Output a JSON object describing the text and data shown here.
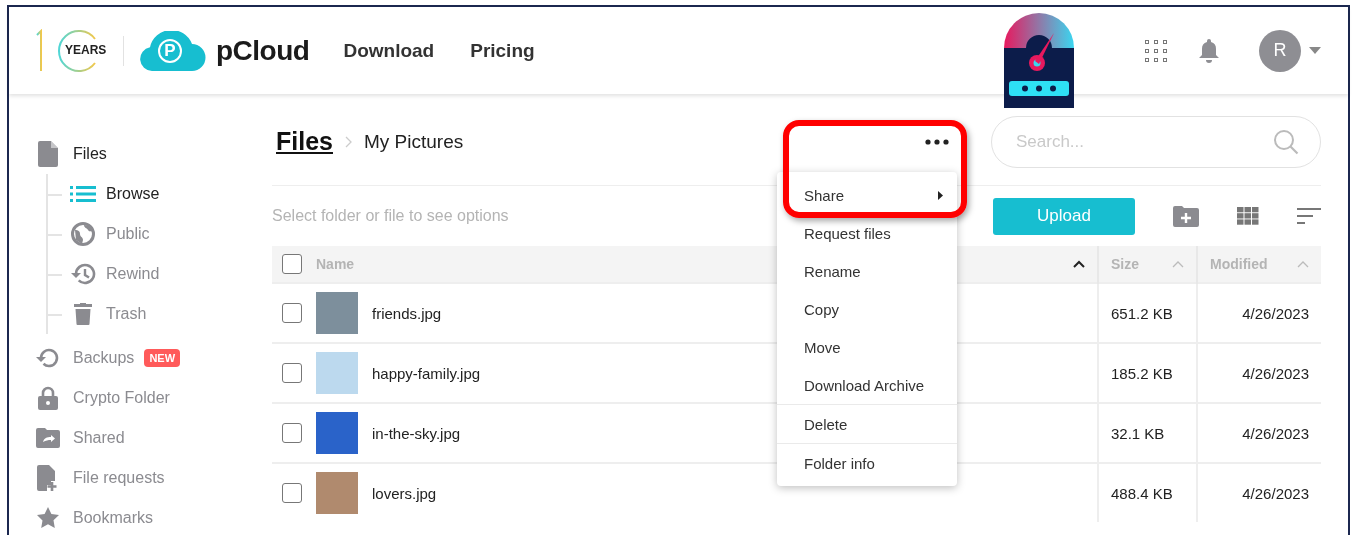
{
  "header": {
    "anniversary_label": "YEARS",
    "logo_mark": "P",
    "brand": "pCloud",
    "nav": [
      "Download",
      "Pricing"
    ],
    "avatar_initial": "R"
  },
  "sidebar": {
    "items": [
      {
        "label": "Files",
        "selected": true,
        "children": [
          {
            "label": "Browse",
            "selected": true
          },
          {
            "label": "Public",
            "selected": false
          },
          {
            "label": "Rewind",
            "selected": false
          },
          {
            "label": "Trash",
            "selected": false
          }
        ]
      },
      {
        "label": "Backups",
        "selected": false,
        "badge": "NEW"
      },
      {
        "label": "Crypto Folder",
        "selected": false
      },
      {
        "label": "Shared",
        "selected": false
      },
      {
        "label": "File requests",
        "selected": false
      },
      {
        "label": "Bookmarks",
        "selected": false
      }
    ]
  },
  "breadcrumb": [
    "Files",
    "My Pictures"
  ],
  "search": {
    "placeholder": "Search..."
  },
  "toolbar": {
    "hint": "Select folder or file to see options",
    "upload": "Upload"
  },
  "table": {
    "select_all_checked": false,
    "columns": [
      {
        "label": "Name",
        "sort_active": true
      },
      {
        "label": "Size",
        "sort_active": false
      },
      {
        "label": "Modified",
        "sort_active": false
      }
    ],
    "rows": [
      {
        "checked": false,
        "name": "friends.jpg",
        "size": "651.2 KB",
        "modified": "4/26/2023",
        "color": "#7d8f9c"
      },
      {
        "checked": false,
        "name": "happy-family.jpg",
        "size": "185.2 KB",
        "modified": "4/26/2023",
        "color": "#bcd9ee"
      },
      {
        "checked": false,
        "name": "in-the-sky.jpg",
        "size": "32.1 KB",
        "modified": "4/26/2023",
        "color": "#2a63c9"
      },
      {
        "checked": false,
        "name": "lovers.jpg",
        "size": "488.4 KB",
        "modified": "4/26/2023",
        "color": "#b08a6e"
      }
    ]
  },
  "context_menu": {
    "items": [
      {
        "label": "Share",
        "has_submenu": true,
        "divider_before": false
      },
      {
        "label": "Request files",
        "has_submenu": false,
        "divider_before": false
      },
      {
        "label": "Rename",
        "has_submenu": false,
        "divider_before": false
      },
      {
        "label": "Copy",
        "has_submenu": false,
        "divider_before": false
      },
      {
        "label": "Move",
        "has_submenu": false,
        "divider_before": false
      },
      {
        "label": "Download Archive",
        "has_submenu": false,
        "divider_before": false
      },
      {
        "label": "Delete",
        "has_submenu": false,
        "divider_before": true
      },
      {
        "label": "Folder info",
        "has_submenu": false,
        "divider_before": true
      }
    ]
  }
}
